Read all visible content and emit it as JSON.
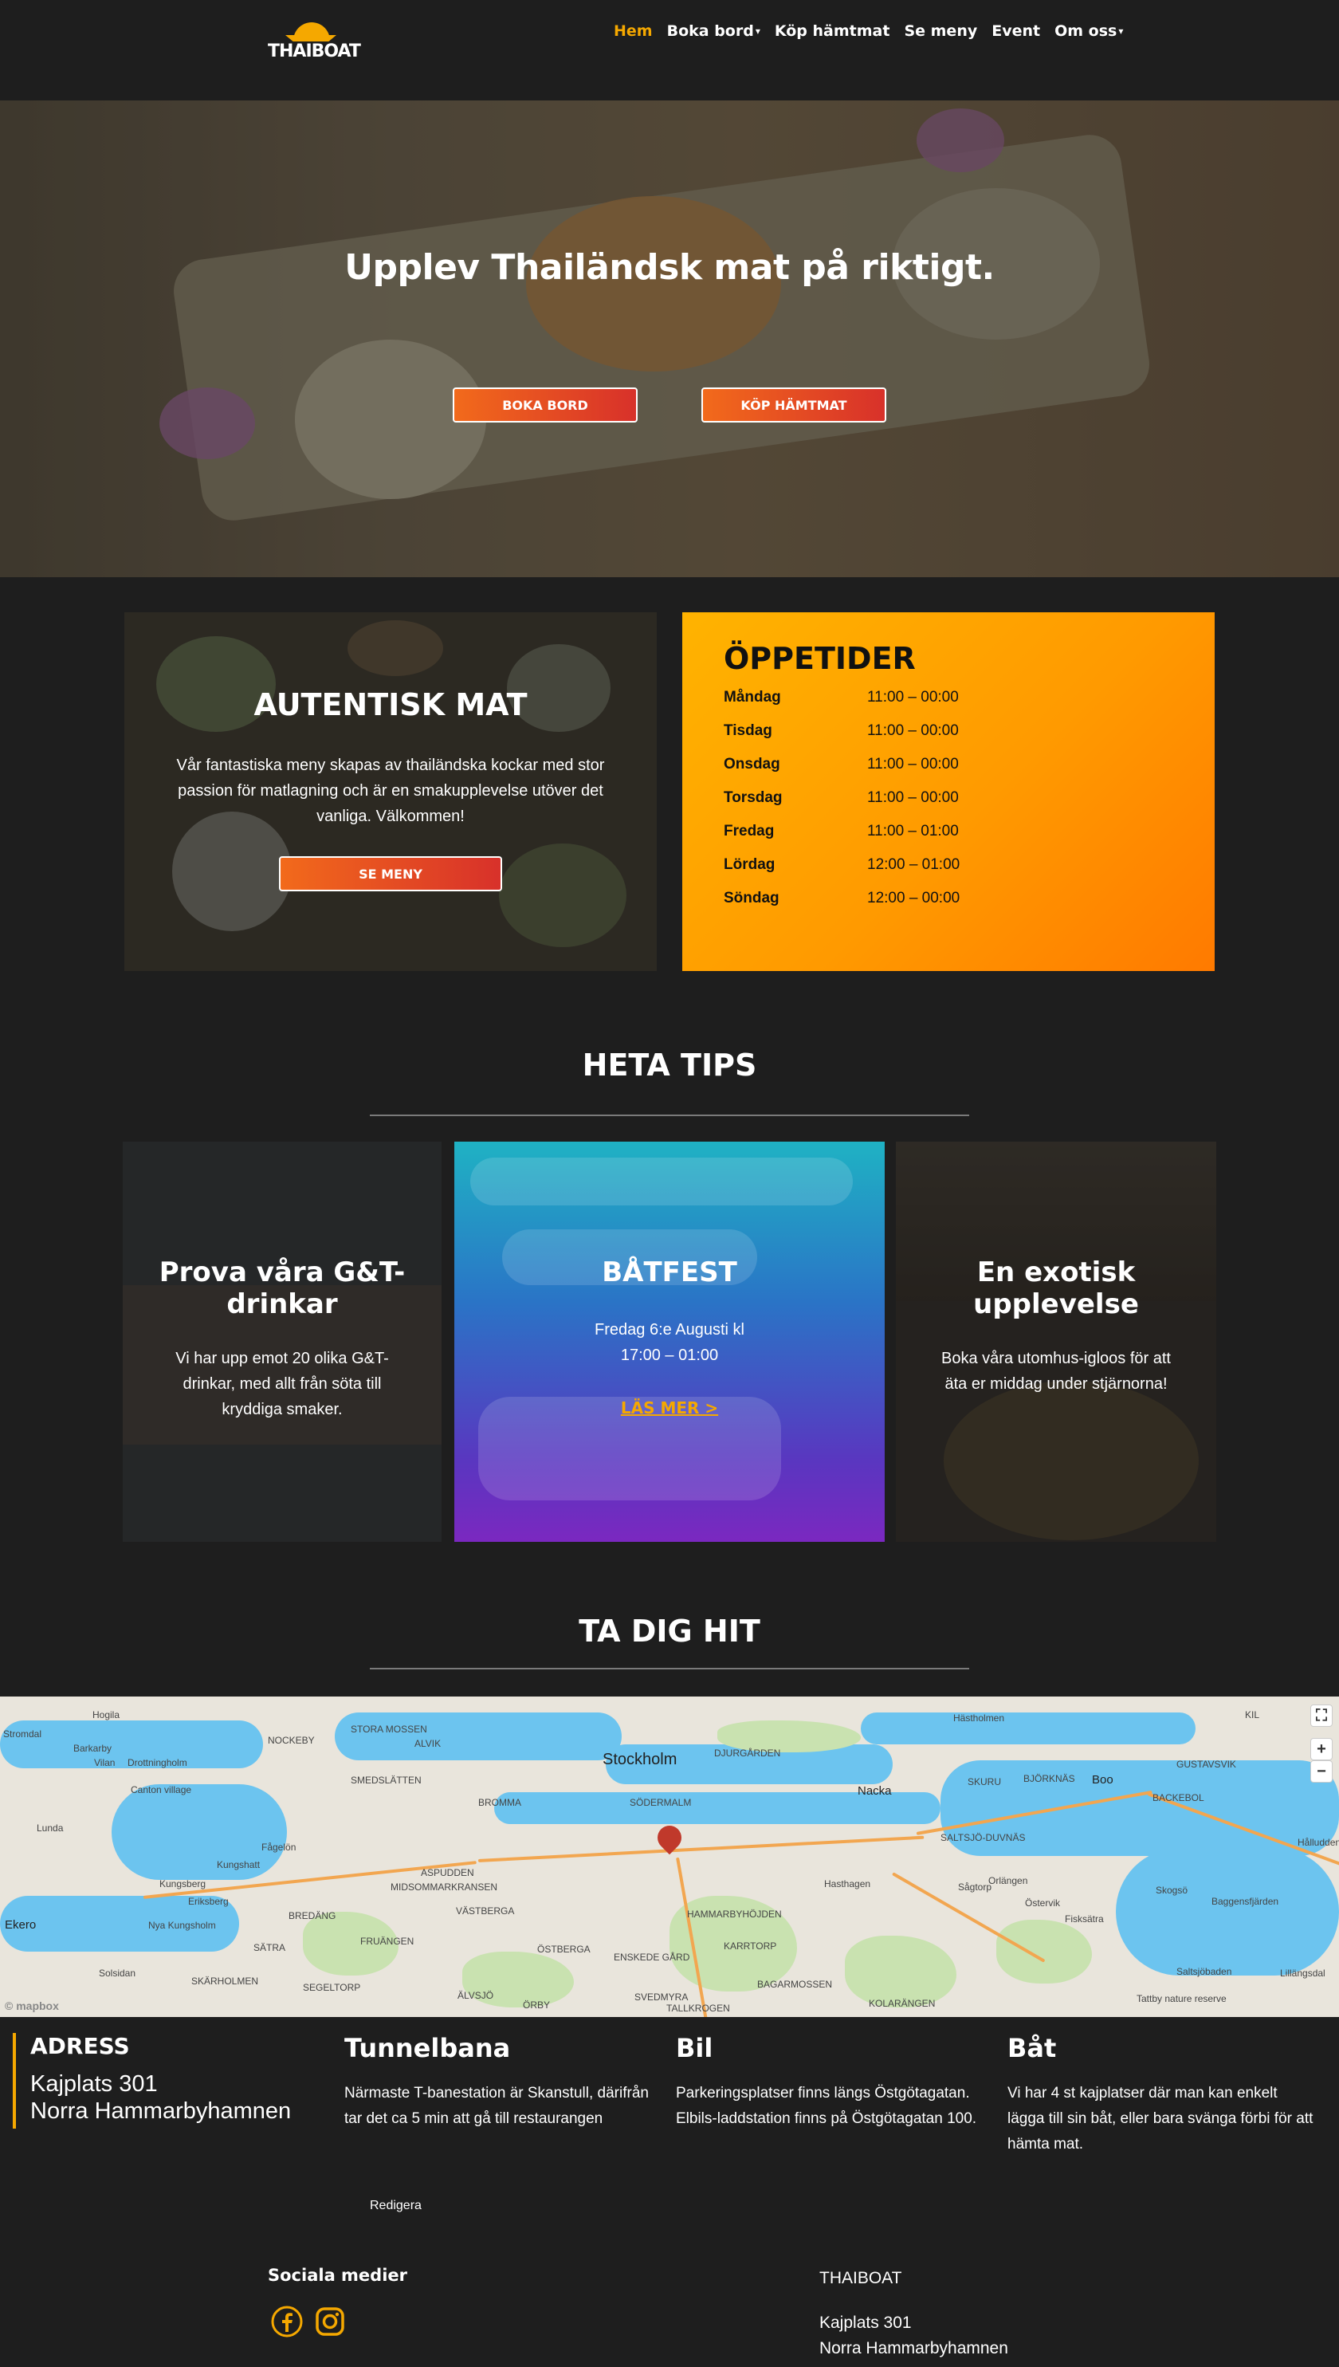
{
  "header": {
    "logo_text": "THAIBOAT",
    "nav": [
      {
        "label": "Hem",
        "active": true,
        "dropdown": false
      },
      {
        "label": "Boka bord",
        "active": false,
        "dropdown": true
      },
      {
        "label": "Köp hämtmat",
        "active": false,
        "dropdown": false
      },
      {
        "label": "Se meny",
        "active": false,
        "dropdown": false
      },
      {
        "label": "Event",
        "active": false,
        "dropdown": false
      },
      {
        "label": "Om oss",
        "active": false,
        "dropdown": true
      }
    ],
    "caret": "▾"
  },
  "hero": {
    "title": "Upplev Thailändsk mat på riktigt.",
    "button_book": "BOKA BORD",
    "button_takeaway": "KÖP HÄMTMAT"
  },
  "authentic": {
    "title": "AUTENTISK MAT",
    "text": "Vår fantastiska meny skapas av thailändska kockar med stor passion för matlagning och är en smakupplevelse utöver det vanliga. Välkommen!",
    "button": "SE MENY"
  },
  "hours": {
    "title": "ÖPPETIDER",
    "rows": [
      {
        "day": "Måndag",
        "time": "11:00 – 00:00"
      },
      {
        "day": "Tisdag",
        "time": "11:00 – 00:00"
      },
      {
        "day": "Onsdag",
        "time": "11:00 – 00:00"
      },
      {
        "day": "Torsdag",
        "time": "11:00 – 00:00"
      },
      {
        "day": "Fredag",
        "time": "11:00 – 01:00"
      },
      {
        "day": "Lördag",
        "time": "12:00 – 01:00"
      },
      {
        "day": "Söndag",
        "time": "12:00 – 00:00"
      }
    ]
  },
  "tips": {
    "title": "HETA TIPS",
    "cards": [
      {
        "title": "Prova våra G&T-drinkar",
        "text": "Vi har upp emot 20 olika G&T-drinkar, med allt från söta till kryddiga smaker."
      },
      {
        "title": "BÅTFEST",
        "text": "Fredag 6:e Augusti kl 17:00 – 01:00",
        "link": "LÄS MER >"
      },
      {
        "title": "En exotisk upplevelse",
        "text": "Boka våra utomhus-igloos för att äta er middag under stjärnorna!"
      }
    ]
  },
  "directions": {
    "title": "TA DIG HIT",
    "map": {
      "city": "Stockholm",
      "attribution": "© mapbox",
      "zoom_in": "+",
      "zoom_out": "−",
      "fullscreen": "⛶",
      "labels": [
        "Hogila",
        "Stromdal",
        "Barkarby",
        "Vilan",
        "Drottningholm",
        "Canton village",
        "Lunda",
        "Kungsberg",
        "Eriksberg",
        "Nya Kungsholm",
        "Ekero",
        "Solsidan",
        "NOCKEBY",
        "STORA MOSSEN",
        "ALVIK",
        "SMEDSLÄTTEN",
        "BROMMA",
        "ÄLVSJÖ",
        "Fågelön",
        "Kungshatt",
        "ASPUDDEN",
        "MIDSOMMARKRANSEN",
        "VÄSTBERGA",
        "BREDÄNG",
        "SÄTRA",
        "SKÄRHOLMEN",
        "SEGELTORP",
        "FRUÄNGEN",
        "ÖSTBERGA",
        "ENSKEDE GÅRD",
        "SÖDERMALM",
        "DJURGÅRDEN",
        "HAMMARBYHÖJDEN",
        "BAGARMOSSEN",
        "KARRTORP",
        "Nacka",
        "Hasthagen",
        "SALTSJÖ-DUVNÄS",
        "Boo",
        "BJÖRKNÄS",
        "SKURU",
        "GUSTAVSVIK",
        "BACKEBOL",
        "Hålludden",
        "Skogsö",
        "Baggensfjärden",
        "Fisksätra",
        "Saltsjöbaden",
        "Lillängsdal",
        "Tattby nature reserve",
        "KOLARÄNGEN",
        "SVEDMYRA",
        "ÖRBY",
        "Sågtorp",
        "Orlängen",
        "TALLKROGEN",
        "Östervik",
        "KIL",
        "Hästholmen"
      ]
    }
  },
  "info": {
    "address": {
      "title": "ADRESS",
      "line1": "Kajplats 301",
      "line2": "Norra Hammarbyhamnen"
    },
    "columns": [
      {
        "title": "Tunnelbana",
        "text": "Närmaste T-banestation är Skanstull, därifrån tar det ca 5 min att gå till restaurangen"
      },
      {
        "title": "Bil",
        "text": "Parkeringsplatser finns längs Östgötagatan. Elbils-laddstation finns på Östgötagatan 100."
      },
      {
        "title": "Båt",
        "text": "Vi har 4 st kajplatser där man kan enkelt lägga till sin båt, eller bara svänga förbi för att hämta mat."
      }
    ],
    "edit_link": "Redigera"
  },
  "footer": {
    "social_title": "Sociala medier",
    "brand": "THAIBOAT",
    "address_line1": "Kajplats 301",
    "address_line2": "Norra Hammarbyhamnen"
  },
  "colors": {
    "accent": "#f5a800",
    "background": "#1e1e1e",
    "button_start": "#f26a1b",
    "button_end": "#d8312a"
  }
}
